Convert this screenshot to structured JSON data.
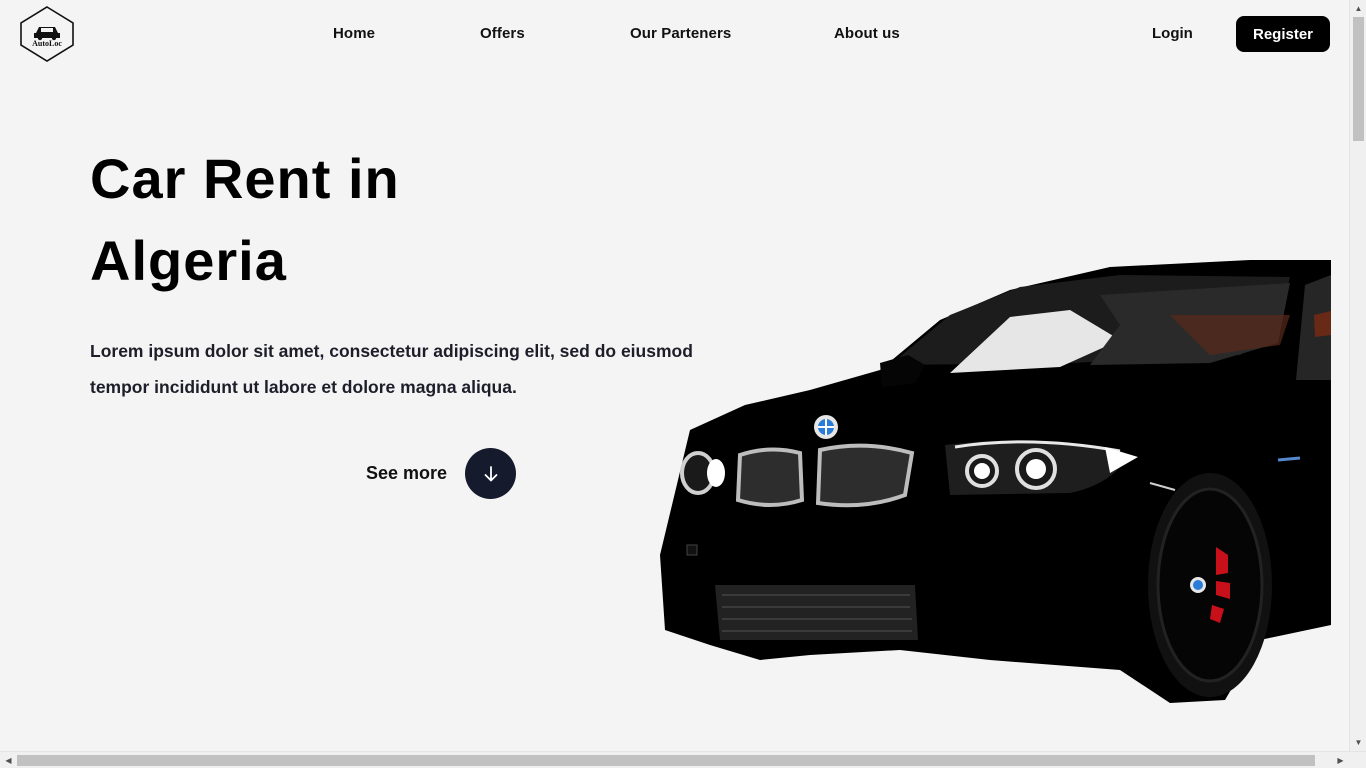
{
  "header": {
    "logo_text": "AutoLoc",
    "nav": [
      "Home",
      "Offers",
      "Our Parteners",
      "About us"
    ],
    "login_label": "Login",
    "register_label": "Register"
  },
  "hero": {
    "title_line1": "Car Rent in",
    "title_line2": "Algeria",
    "text_line1": "Lorem ipsum dolor sit amet, consectetur adipiscing elit, sed do eiusmod",
    "text_line2": "tempor incididunt ut labore et dolore magna aliqua.",
    "see_more_label": "See more"
  },
  "icons": {
    "logo": "car-logo-icon",
    "see_more": "arrow-down-icon",
    "scroll_up": "scroll-up-icon",
    "scroll_down": "scroll-down-icon",
    "scroll_left": "scroll-left-icon",
    "scroll_right": "scroll-right-icon"
  },
  "colors": {
    "background": "#f4f4f4",
    "register_bg": "#000000",
    "arrow_button_bg": "#151a2c",
    "car_body": "#000000",
    "brake_caliper": "#c8101a"
  }
}
